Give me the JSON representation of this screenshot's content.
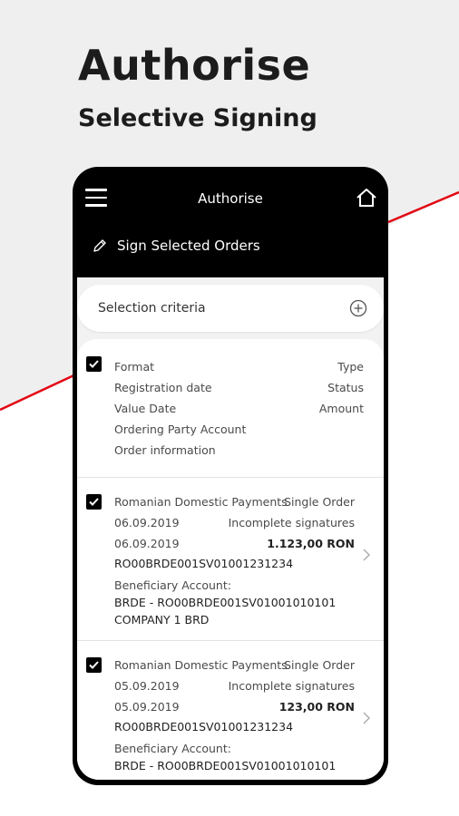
{
  "hero": {
    "title": "Authorise",
    "subtitle": "Selective Signing"
  },
  "appbar": {
    "title": "Authorise",
    "sign_label": "Sign Selected Orders"
  },
  "criteria": {
    "label": "Selection criteria"
  },
  "header_row": {
    "left": [
      "Format",
      "Registration date",
      "Value Date",
      "Ordering Party Account",
      "Order information"
    ],
    "right": [
      "Type",
      "Status",
      "Amount"
    ]
  },
  "orders": [
    {
      "format": "Romanian Domestic Payments",
      "type": "Single Order",
      "registration_date": "06.09.2019",
      "status": "Incomplete signatures",
      "value_date": "06.09.2019",
      "amount": "1.123,00 RON",
      "ordering_account": "RO00BRDE001SV01001231234",
      "beneficiary_label": "Beneficiary Account:",
      "beneficiary_account": "BRDE - RO00BRDE001SV01001010101",
      "beneficiary_name": "COMPANY 1 BRD"
    },
    {
      "format": "Romanian Domestic Payments",
      "type": "Single Order",
      "registration_date": "05.09.2019",
      "status": "Incomplete signatures",
      "value_date": "05.09.2019",
      "amount": "123,00 RON",
      "ordering_account": "RO00BRDE001SV01001231234",
      "beneficiary_label": "Beneficiary Account:",
      "beneficiary_account": "BRDE - RO00BRDE001SV01001010101"
    }
  ],
  "colors": {
    "accent_red": "#e30613",
    "background_grey": "#efefef",
    "phone_black": "#000000"
  }
}
